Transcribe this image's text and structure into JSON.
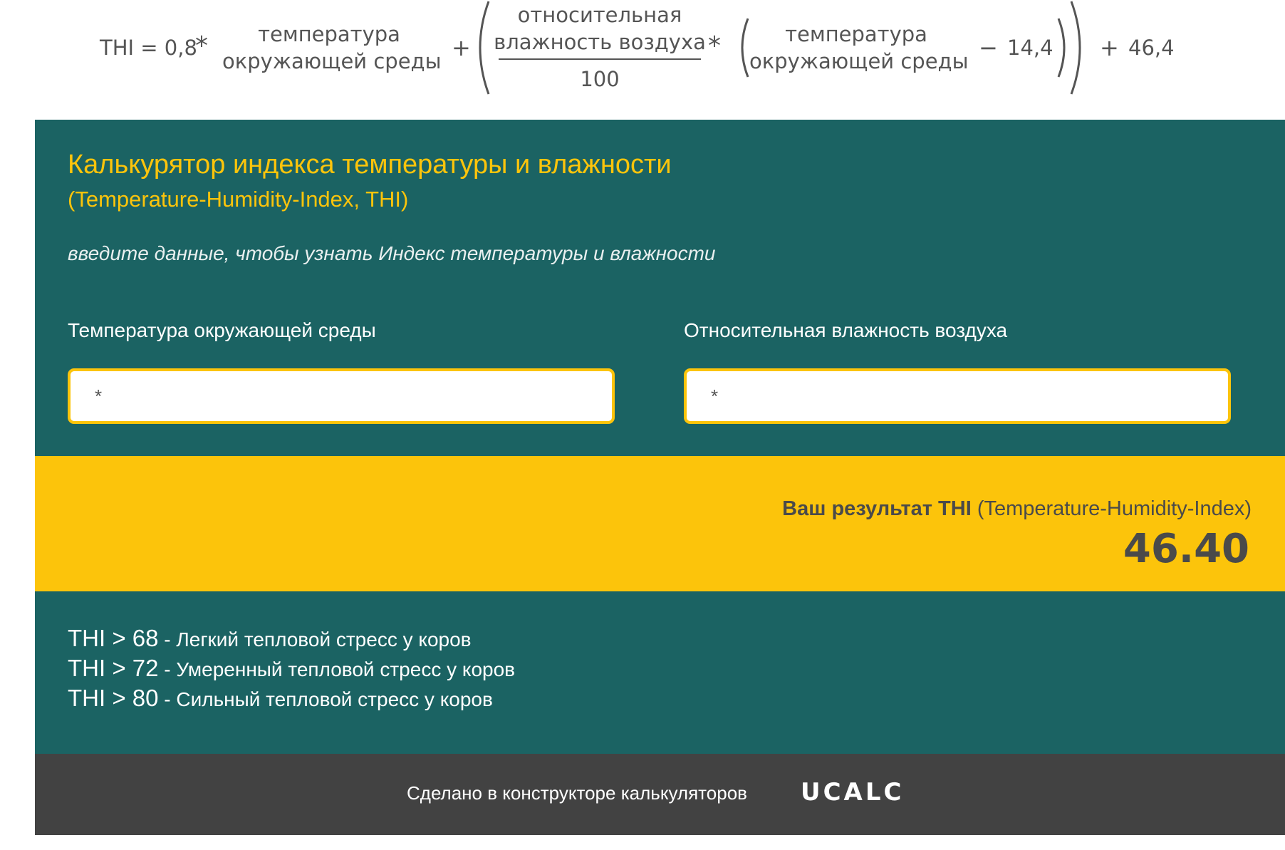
{
  "formula": {
    "lead": "THI = 0,8",
    "multiply": "*",
    "plus": "+",
    "minus": "−",
    "temp_line1": "температура",
    "temp_line2": "окружающей среды",
    "hum_line1": "относительная",
    "hum_line2": "влажность воздуха",
    "divisor": "100",
    "const_sub": "14,4",
    "const_add": "46,4"
  },
  "calculator": {
    "title": "Калькурятор индекса температуры и влажности",
    "subtitle": "(Temperature-Humidity-Index, THI)",
    "instruction": "введите данные, чтобы узнать Индекс температуры и влажности",
    "fields": {
      "temperature": {
        "label": "Температура окружающей среды",
        "placeholder": "*",
        "value": ""
      },
      "humidity": {
        "label": "Относительная влажность воздуха",
        "placeholder": "*",
        "value": ""
      }
    },
    "result": {
      "label_bold": "Ваш результат THI",
      "label_rest": " (Temperature-Humidity-Index)",
      "value": "46.40"
    },
    "thresholds": [
      {
        "thi": "THI > 68",
        "desc": " - Легкий тепловой стресс у коров"
      },
      {
        "thi": "THI > 72",
        "desc": " - Умеренный тепловой стресс у коров"
      },
      {
        "thi": "THI > 80",
        "desc": " - Сильный тепловой стресс у коров"
      }
    ],
    "footer": {
      "text": "Сделано в конструкторе калькуляторов",
      "logo": "UCALC"
    }
  },
  "colors": {
    "teal": "#1b6363",
    "accent_yellow": "#fcc40b",
    "footer_gray": "#424242",
    "formula_text": "#555555"
  }
}
